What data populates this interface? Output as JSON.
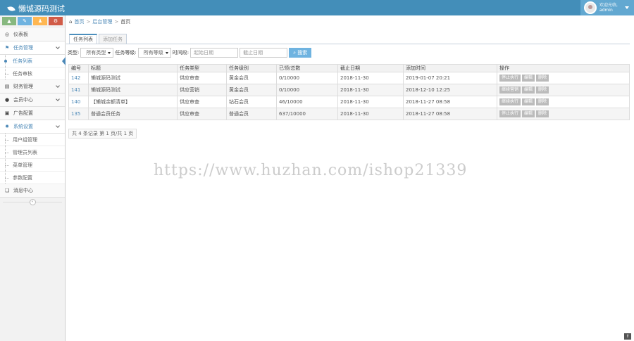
{
  "app": {
    "title": "懒城源码测试"
  },
  "user": {
    "welcome": "欢迎光临,",
    "name": "admin"
  },
  "shortcuts": [
    {
      "icon": "signal-icon",
      "color": "#87b87f",
      "glyph": "▲"
    },
    {
      "icon": "pencil-icon",
      "color": "#6fb3e0",
      "glyph": "✎"
    },
    {
      "icon": "group-icon",
      "color": "#ffb752",
      "glyph": "♟"
    },
    {
      "icon": "settings-icon",
      "color": "#d15b47",
      "glyph": "⚙"
    }
  ],
  "sidebar": {
    "dashboard": "仪表板",
    "task_mgmt": "任务管理",
    "task_list": "任务列表",
    "task_review": "任务审核",
    "finance": "财务管理",
    "members": "会员中心",
    "ads": "广告配置",
    "settings": "系统设置",
    "settings_items": [
      "用户组管理",
      "管理员列表",
      "菜单管理",
      "参数配置"
    ],
    "messages": "消息中心",
    "collapse": "«"
  },
  "breadcrumb": {
    "home": "首页",
    "section": "后台管理",
    "page": "首页"
  },
  "tabs": [
    "任务列表",
    "添加任务"
  ],
  "filters": {
    "type_label": "类型:",
    "type_value": "所有类型",
    "level_label": "任务等级:",
    "level_value": "所有等级",
    "time_label": "时间段:",
    "start_placeholder": "起始日期",
    "end_placeholder": "截止日期",
    "search_label": "搜索"
  },
  "table": {
    "headers": [
      "编号",
      "标题",
      "任务类型",
      "任务级别",
      "已领/总数",
      "截止日期",
      "添加时间",
      "操作"
    ],
    "rows": [
      {
        "id": "142",
        "title": "懒城源码测试",
        "type": "供应审查",
        "level": "黄金会员",
        "count": "0/10000",
        "deadline": "2018-11-30",
        "added": "2019-01-07 20:21",
        "actions": [
          "停止执行",
          "编辑",
          "删除"
        ]
      },
      {
        "id": "141",
        "title": "懒城源码测试",
        "type": "供应营销",
        "level": "黄金会员",
        "count": "0/10000",
        "deadline": "2018-11-30",
        "added": "2018-12-10 12:25",
        "actions": [
          "继续营销",
          "编辑",
          "删除"
        ]
      },
      {
        "id": "140",
        "title": "【懒城余额清单】",
        "type": "供应审查",
        "level": "钻石会员",
        "count": "46/10000",
        "deadline": "2018-11-30",
        "added": "2018-11-27 08:58",
        "actions": [
          "继续执行",
          "编辑",
          "删除"
        ]
      },
      {
        "id": "135",
        "title": "普通会员任务",
        "type": "供应审查",
        "level": "普通会员",
        "count": "637/10000",
        "deadline": "2018-11-30",
        "added": "2018-11-27 08:58",
        "actions": [
          "停止执行",
          "编辑",
          "删除"
        ]
      }
    ]
  },
  "pager": {
    "text": "共 4 条记录 第 1 页/共 1 页"
  },
  "watermark": "https://www.huzhan.com/ishop21339",
  "totop": "⇑"
}
